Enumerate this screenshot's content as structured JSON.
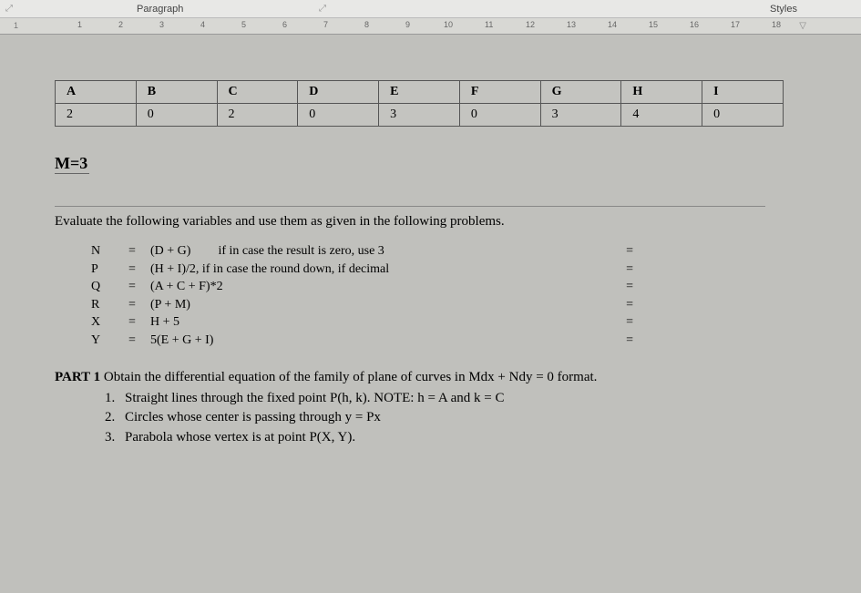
{
  "toolbar": {
    "paragraph_label": "Paragraph",
    "styles_label": "Styles"
  },
  "ruler": {
    "left_mark": "1",
    "numbers": [
      1,
      2,
      3,
      4,
      5,
      6,
      7,
      8,
      9,
      10,
      11,
      12,
      13,
      14,
      15,
      16,
      17,
      18
    ]
  },
  "table": {
    "headers": [
      "A",
      "B",
      "C",
      "D",
      "E",
      "F",
      "G",
      "H",
      "I"
    ],
    "values": [
      "2",
      "0",
      "2",
      "0",
      "3",
      "0",
      "3",
      "4",
      "0"
    ]
  },
  "m_equals": "M=3",
  "instruction": "Evaluate the following variables and use them as given in the following problems.",
  "vars": [
    {
      "name": "N",
      "expr": "(D + G)",
      "cond": "if in case the result is zero, use 3",
      "right": "="
    },
    {
      "name": "P",
      "expr": "(H + I)/2, if in case the round down, if decimal",
      "cond": "",
      "right": "="
    },
    {
      "name": "Q",
      "expr": "(A + C + F)*2",
      "cond": "",
      "right": "="
    },
    {
      "name": "R",
      "expr": "(P + M)",
      "cond": "",
      "right": "="
    },
    {
      "name": "X",
      "expr": "H + 5",
      "cond": "",
      "right": "="
    },
    {
      "name": "Y",
      "expr": "5(E + G + I)",
      "cond": "",
      "right": "="
    }
  ],
  "part1": {
    "title_bold": "PART 1",
    "title_rest": " Obtain the differential equation of the family of plane of curves in Mdx + Ndy = 0 format.",
    "items": [
      "Straight lines through the fixed point P(h, k). NOTE: h = A and k = C",
      "Circles whose center is passing through y = Px",
      "Parabola whose vertex is at point P(X, Y)."
    ]
  }
}
